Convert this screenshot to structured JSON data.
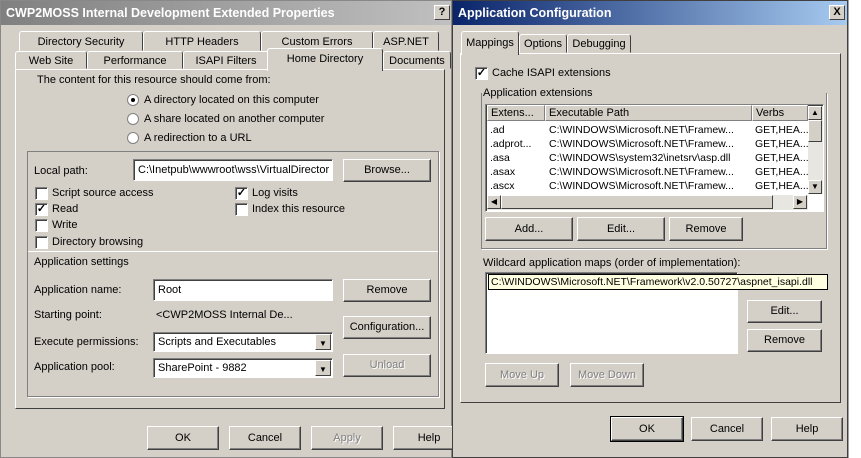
{
  "left_dialog": {
    "title": "CWP2MOSS Internal Development Extended Properties",
    "help_glyph": "?",
    "tabs_row1": [
      "Directory Security",
      "HTTP Headers",
      "Custom Errors",
      "ASP.NET"
    ],
    "tabs_row2": [
      "Web Site",
      "Performance",
      "ISAPI Filters",
      "Home Directory",
      "Documents"
    ],
    "selected_tab": "Home Directory",
    "source_heading": "The content for this resource should come from:",
    "source_options": [
      "A directory located on this computer",
      "A share located on another computer",
      "A redirection to a URL"
    ],
    "local_path_label": "Local path:",
    "local_path_value": "C:\\Inetpub\\wwwroot\\wss\\VirtualDirector",
    "browse_label": "Browse...",
    "checkboxes": [
      {
        "label": "Script source access",
        "checked": false
      },
      {
        "label": "Read",
        "checked": true
      },
      {
        "label": "Write",
        "checked": false
      },
      {
        "label": "Directory browsing",
        "checked": false
      },
      {
        "label": "Log visits",
        "checked": true
      },
      {
        "label": "Index this resource",
        "checked": false
      }
    ],
    "app_settings_heading": "Application settings",
    "app_name_label": "Application name:",
    "app_name_value": "Root",
    "remove_label": "Remove",
    "starting_point_label": "Starting point:",
    "starting_point_value": "<CWP2MOSS Internal De...",
    "configuration_label": "Configuration...",
    "execute_permissions_label": "Execute permissions:",
    "execute_permissions_value": "Scripts and Executables",
    "app_pool_label": "Application pool:",
    "app_pool_value": "SharePoint - 9882",
    "unload_label": "Unload",
    "ok_label": "OK",
    "cancel_label": "Cancel",
    "apply_label": "Apply",
    "help_label": "Help"
  },
  "right_dialog": {
    "title": "Application Configuration",
    "close_glyph": "X",
    "tabs": [
      "Mappings",
      "Options",
      "Debugging"
    ],
    "selected_tab": "Mappings",
    "cache_isapi_label": "Cache ISAPI extensions",
    "cache_isapi_checked": true,
    "app_extensions_heading": "Application extensions",
    "columns": [
      "Extens...",
      "Executable Path",
      "Verbs"
    ],
    "rows": [
      {
        "ext": ".ad",
        "path": "C:\\WINDOWS\\Microsoft.NET\\Framew...",
        "verbs": "GET,HEA..."
      },
      {
        "ext": ".adprot...",
        "path": "C:\\WINDOWS\\Microsoft.NET\\Framew...",
        "verbs": "GET,HEA..."
      },
      {
        "ext": ".asa",
        "path": "C:\\WINDOWS\\system32\\inetsrv\\asp.dll",
        "verbs": "GET,HEA..."
      },
      {
        "ext": ".asax",
        "path": "C:\\WINDOWS\\Microsoft.NET\\Framew...",
        "verbs": "GET,HEA..."
      },
      {
        "ext": ".ascx",
        "path": "C:\\WINDOWS\\Microsoft.NET\\Framew...",
        "verbs": "GET,HEA..."
      }
    ],
    "add_label": "Add...",
    "edit_label": "Edit...",
    "remove_label": "Remove",
    "wildcard_heading": "Wildcard application maps (order of implementation):",
    "wildcard_entry": "C:\\WINDOWS\\Microsoft.NET\\Framework\\v2.0.50727\\aspnet_isapi.dll",
    "wildcard_edit_label": "Edit...",
    "wildcard_remove_label": "Remove",
    "move_up_label": "Move Up",
    "move_down_label": "Move Down",
    "ok_label": "OK",
    "cancel_label": "Cancel",
    "help_label": "Help"
  }
}
